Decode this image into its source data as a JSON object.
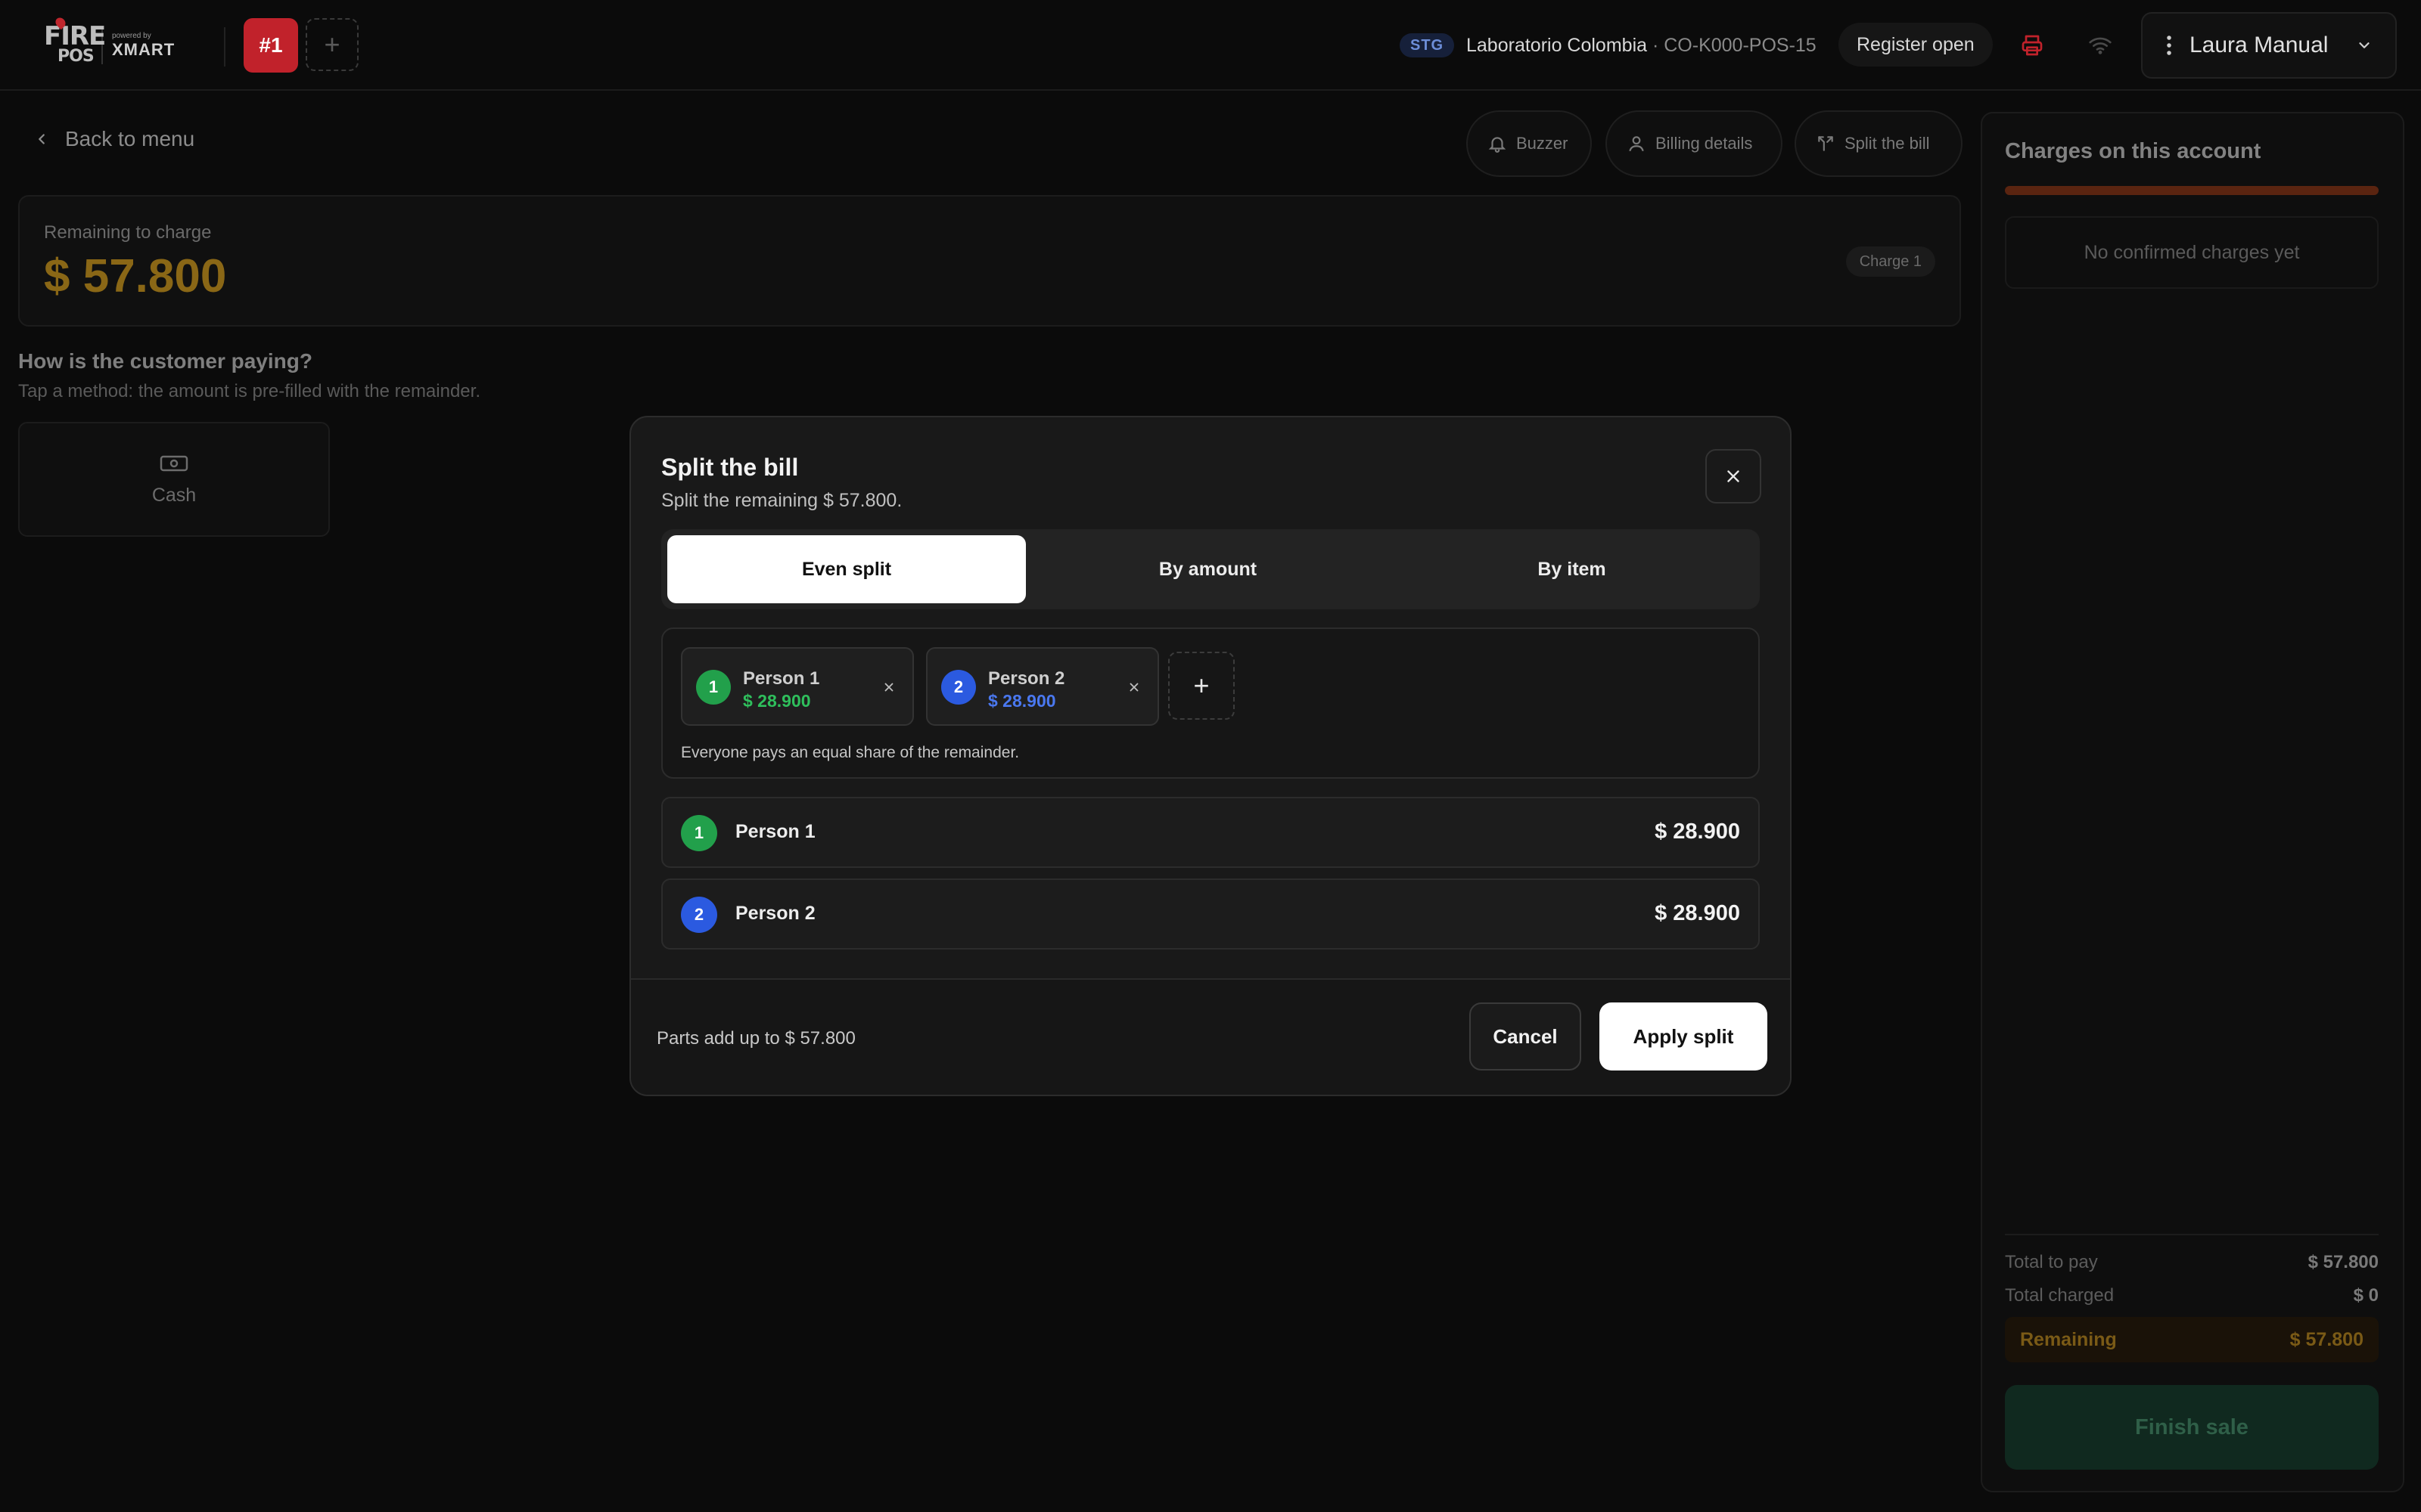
{
  "header": {
    "logo_fire": "FIRE",
    "logo_pos": "POS",
    "logo_powered": "powered by",
    "logo_brand": "XMART",
    "active_tab": "#1",
    "add_tab": "+",
    "env_badge": "STG",
    "store_name": "Laboratorio Colombia",
    "store_code": " · CO-K000-POS-15",
    "register_status": "Register open",
    "user_name": "Laura Manual"
  },
  "main": {
    "back_label": "Back to menu",
    "actions": {
      "buzzer": "Buzzer",
      "billing": "Billing details",
      "split": "Split the bill"
    },
    "remaining_label": "Remaining to charge",
    "remaining_value": "$ 57.800",
    "charge_pill": "Charge 1",
    "how_title": "How is the customer paying?",
    "how_sub": "Tap a method: the amount is pre-filled with the remainder.",
    "cash_label": "Cash"
  },
  "side": {
    "title": "Charges on this account",
    "no_charges": "No confirmed charges yet",
    "total_to_pay_label": "Total to pay",
    "total_to_pay": "$ 57.800",
    "total_charged_label": "Total charged",
    "total_charged": "$ 0",
    "remaining_label": "Remaining",
    "remaining": "$ 57.800",
    "finish": "Finish sale"
  },
  "modal": {
    "title": "Split the bill",
    "subtitle": "Split the remaining $ 57.800.",
    "tabs": [
      "Even split",
      "By amount",
      "By item"
    ],
    "active_tab": "Even split",
    "people": [
      {
        "number": "1",
        "name": "Person 1",
        "amount": "$ 28.900",
        "color": "#22a04b",
        "amount_color": "#2fbf5c"
      },
      {
        "number": "2",
        "name": "Person 2",
        "amount": "$ 28.900",
        "color": "#2b5ae0",
        "amount_color": "#4a78f0"
      }
    ],
    "add_person": "+",
    "note": "Everyone pays an equal share of the remainder.",
    "sum_text": "Parts add up to $ 57.800",
    "cancel": "Cancel",
    "apply": "Apply split"
  },
  "colors": {
    "brand_red": "#c1222b",
    "accent_gold": "#8a6716",
    "finish_green": "#10291f"
  }
}
